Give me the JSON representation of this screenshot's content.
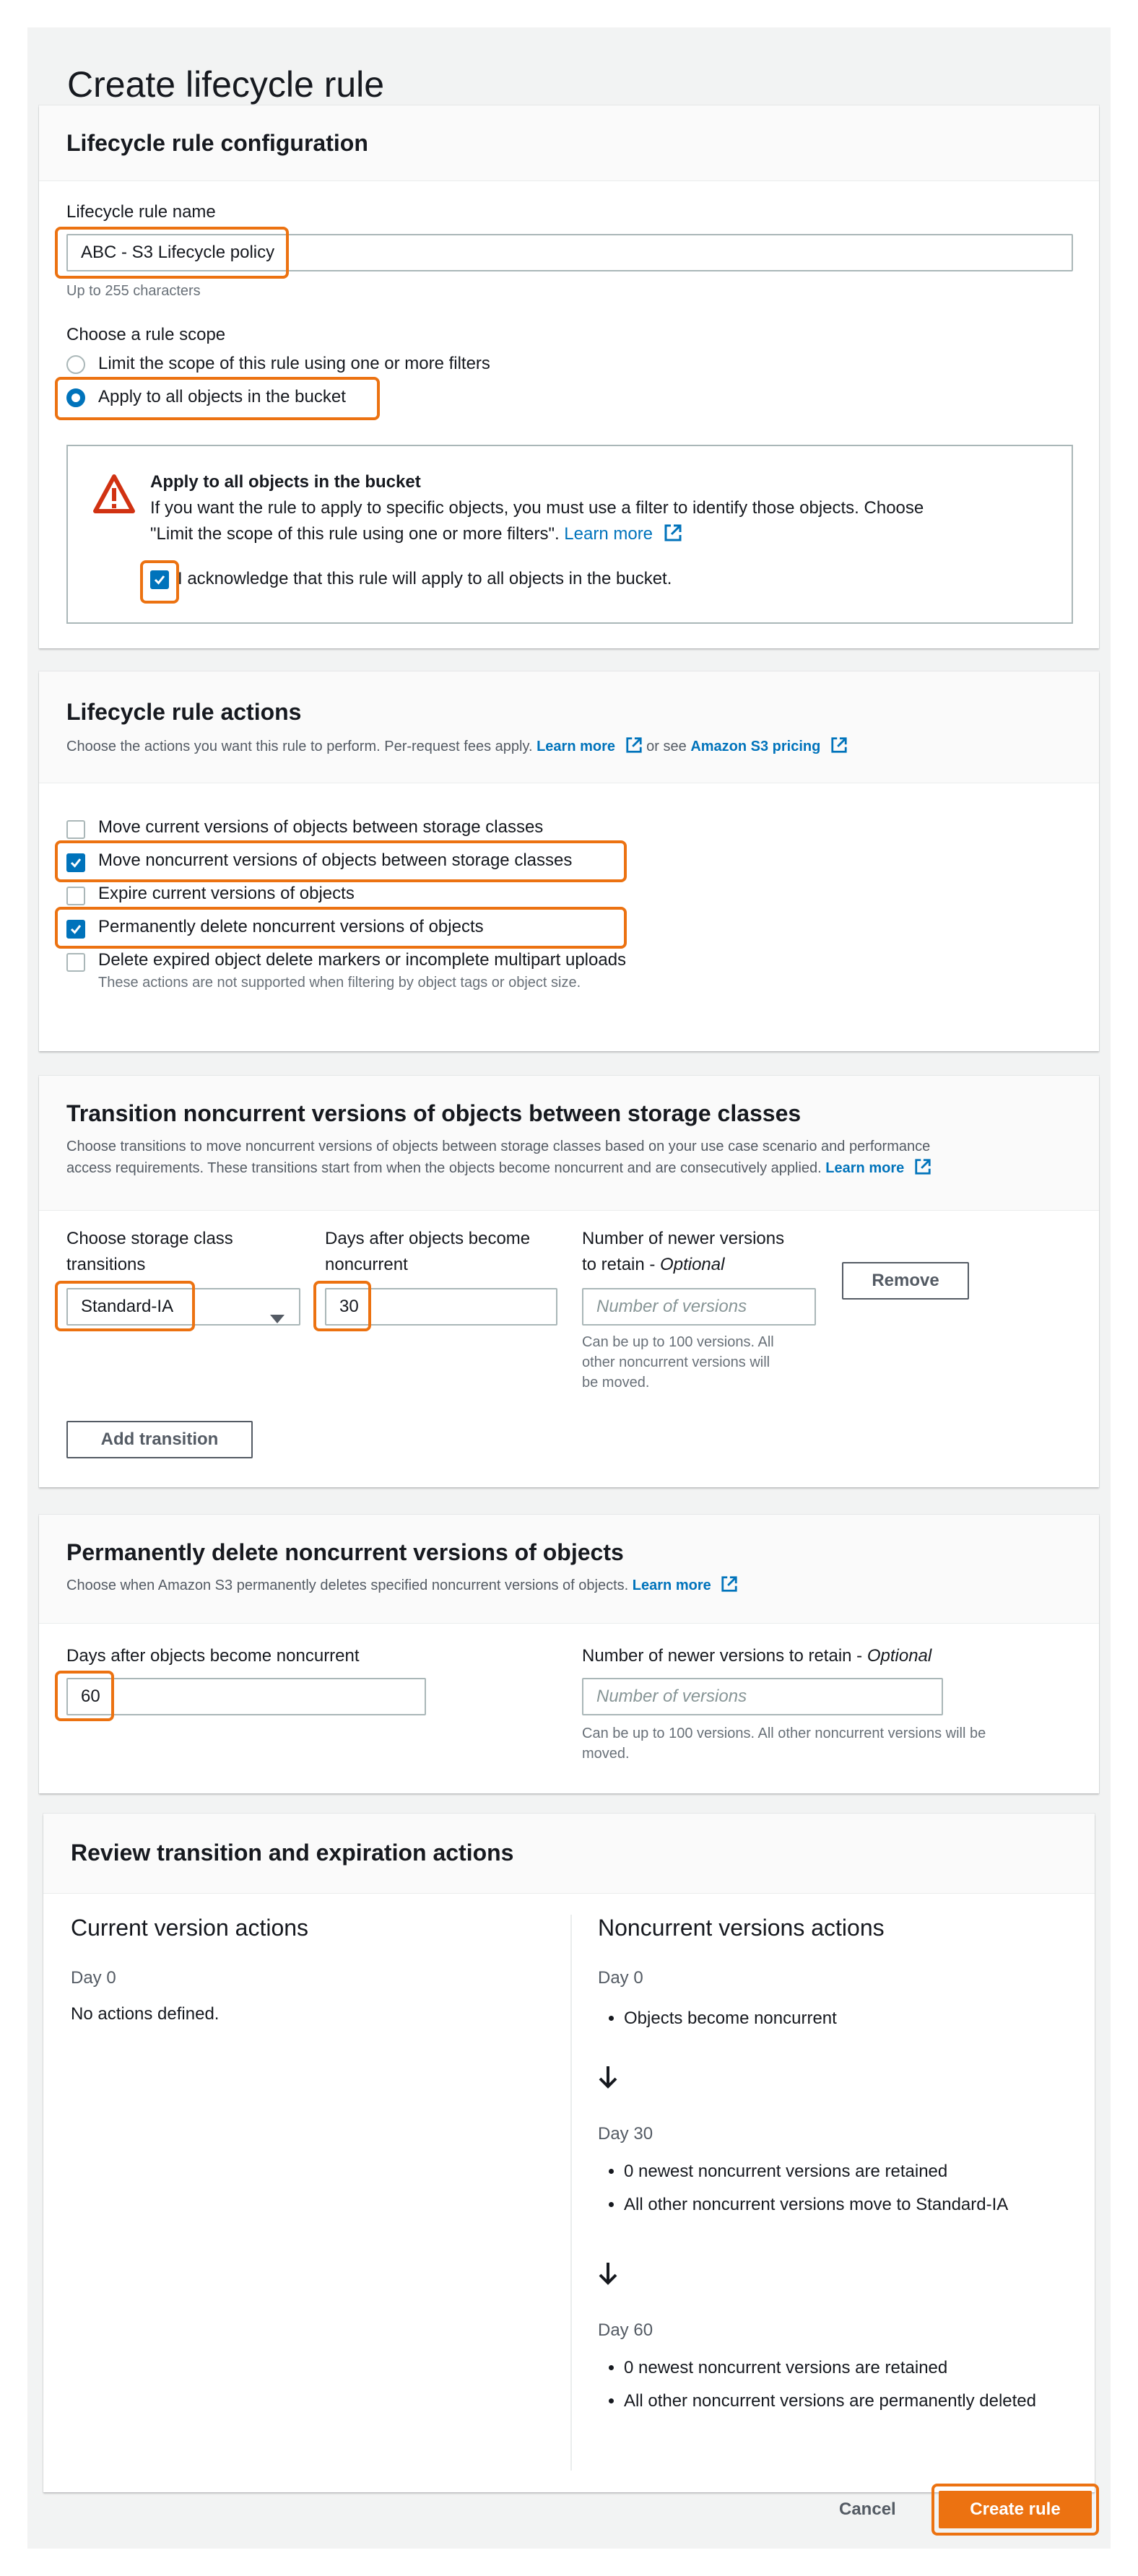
{
  "page_title": "Create lifecycle rule",
  "config": {
    "title": "Lifecycle rule configuration",
    "name_label": "Lifecycle rule name",
    "name_value": "ABC - S3 Lifecycle policy",
    "name_hint": "Up to 255 characters",
    "scope_label": "Choose a rule scope",
    "scope_options": [
      "Limit the scope of this rule using one or more filters",
      "Apply to all objects in the bucket"
    ],
    "scope_selected": "Apply to all objects in the bucket",
    "alert_title": "Apply to all objects in the bucket",
    "alert_text_1": "If you want the rule to apply to specific objects, you must use a filter to identify those objects. Choose",
    "alert_text_2": "\"Limit the scope of this rule using one or more filters\".",
    "alert_link": "Learn more",
    "ack_label": "I acknowledge that this rule will apply to all objects in the bucket.",
    "ack_checked": true
  },
  "actions": {
    "title": "Lifecycle rule actions",
    "desc": "Choose the actions you want this rule to perform. Per-request fees apply.",
    "learn_more": "Learn more",
    "or_see": "or see",
    "pricing_link": "Amazon S3 pricing",
    "items": [
      {
        "label": "Move current versions of objects between storage classes",
        "checked": false
      },
      {
        "label": "Move noncurrent versions of objects between storage classes",
        "checked": true
      },
      {
        "label": "Expire current versions of objects",
        "checked": false
      },
      {
        "label": "Permanently delete noncurrent versions of objects",
        "checked": true
      },
      {
        "label": "Delete expired object delete markers or incomplete multipart uploads",
        "checked": false
      }
    ],
    "items_note": "These actions are not supported when filtering by object tags or object size."
  },
  "transition": {
    "title": "Transition noncurrent versions of objects between storage classes",
    "desc_1": "Choose transitions to move noncurrent versions of objects between storage classes based on your use case scenario and performance",
    "desc_2": "access requirements. These transitions start from when the objects become noncurrent and are consecutively applied.",
    "learn_more": "Learn more",
    "class_label_1": "Choose storage class",
    "class_label_2": "transitions",
    "class_value": "Standard-IA",
    "days_label_1": "Days after objects become",
    "days_label_2": "noncurrent",
    "days_value": "30",
    "versions_label_1": "Number of newer versions",
    "versions_label_2": "to retain - ",
    "optional": "Optional",
    "versions_placeholder": "Number of versions",
    "versions_hint_1": "Can be up to 100 versions. All",
    "versions_hint_2": "other noncurrent versions will",
    "versions_hint_3": "be moved.",
    "remove_button": "Remove",
    "add_button": "Add transition"
  },
  "delete": {
    "title": "Permanently delete noncurrent versions of objects",
    "desc": "Choose when Amazon S3 permanently deletes specified noncurrent versions of objects.",
    "learn_more": "Learn more",
    "days_label": "Days after objects become noncurrent",
    "days_value": "60",
    "versions_label": "Number of newer versions to retain - ",
    "optional": "Optional",
    "versions_placeholder": "Number of versions",
    "versions_hint_1": "Can be up to 100 versions. All other noncurrent versions will be",
    "versions_hint_2": "moved."
  },
  "review": {
    "title": "Review transition and expiration actions",
    "current_title": "Current version actions",
    "current_day": "Day 0",
    "current_text": "No actions defined.",
    "noncurrent_title": "Noncurrent versions actions",
    "day0": "Day 0",
    "day0_items": [
      "Objects become noncurrent"
    ],
    "day30": "Day 30",
    "day30_items": [
      "0 newest noncurrent versions are retained",
      "All other noncurrent versions move to Standard-IA"
    ],
    "day60": "Day 60",
    "day60_items": [
      "0 newest noncurrent versions are retained",
      "All other noncurrent versions are permanently deleted"
    ]
  },
  "footer": {
    "cancel": "Cancel",
    "create": "Create rule"
  },
  "colors": {
    "highlight": "#ec7211",
    "link": "#0073bb",
    "warning": "#d13212"
  }
}
